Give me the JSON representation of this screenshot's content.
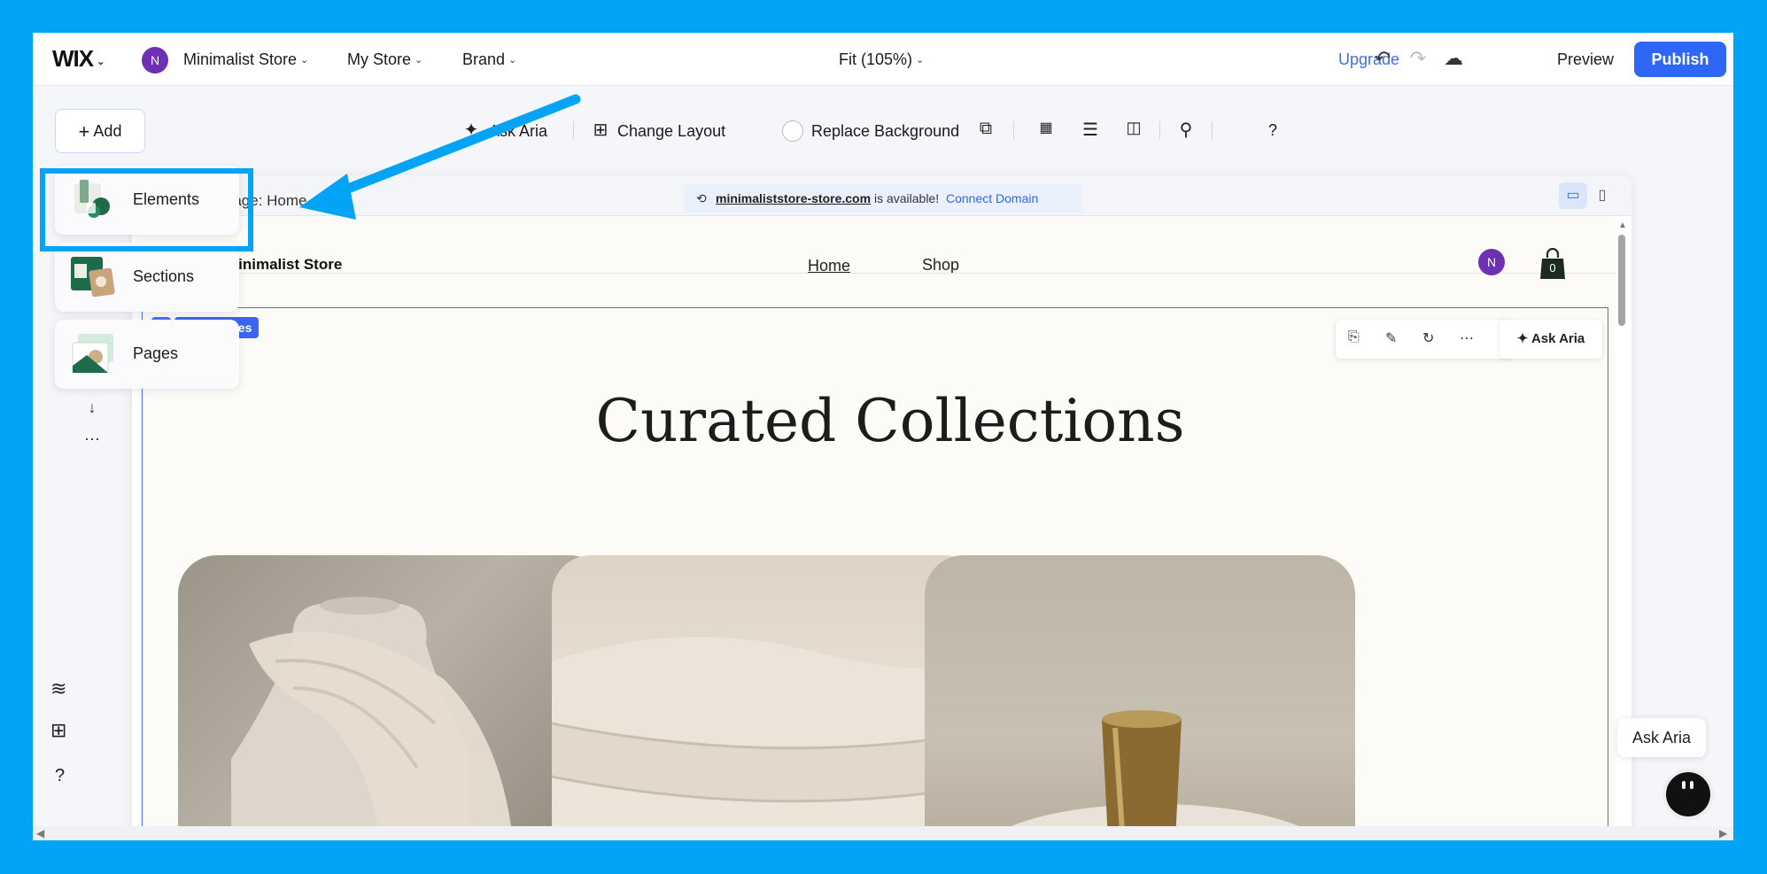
{
  "topbar": {
    "logo": "WIX",
    "avatar_initial": "N",
    "menus": [
      "Minimalist Store",
      "My Store",
      "Brand"
    ],
    "zoom": "Fit (105%)",
    "upgrade": "Upgrade",
    "preview": "Preview",
    "publish": "Publish"
  },
  "toolbar": {
    "add": "Add",
    "ask_aria": "Ask Aria",
    "change_layout": "Change Layout",
    "replace_background": "Replace Background",
    "help": "?"
  },
  "add_panel": {
    "items": [
      {
        "label": "Elements"
      },
      {
        "label": "Sections"
      },
      {
        "label": "Pages"
      }
    ]
  },
  "browser": {
    "page_label": "Page: Home",
    "domain": "minimaliststore-store.com",
    "available_text": "is available!",
    "connect_domain": "Connect Domain"
  },
  "site": {
    "logo": "Minimalist Store",
    "nav": [
      "Home",
      "Shop"
    ],
    "avatar_initial": "N",
    "cart_count": "0",
    "section_tag": "Categories",
    "heading": "Curated Collections",
    "float_ask_aria": "Ask Aria"
  },
  "aria_widget": {
    "label": "Ask Aria"
  },
  "colors": {
    "accent": "#2e67f8",
    "highlight": "#03a3f5",
    "avatar": "#6d2fb3"
  }
}
